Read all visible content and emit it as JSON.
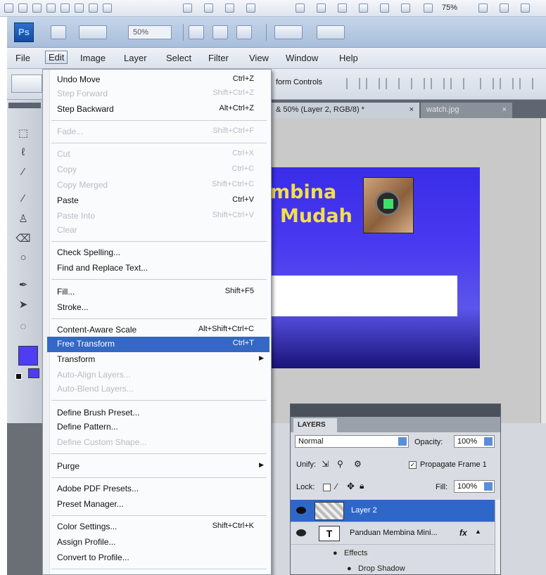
{
  "quicklaunch": {
    "zoom": "75%"
  },
  "appbar": {
    "logo": "Ps",
    "zoom": "50%"
  },
  "menubar": {
    "items": [
      "File",
      "Edit",
      "Image",
      "Layer",
      "Select",
      "Filter",
      "View",
      "Window",
      "Help"
    ],
    "active": "Edit"
  },
  "options_bar": {
    "transform_controls": "form Controls"
  },
  "document_tabs": {
    "active": "& 50% (Layer 2, RGB/8) *",
    "active_close": "×",
    "inactive": "watch.jpg",
    "inactive_close": "×"
  },
  "canvas": {
    "title_line1": "mbina",
    "title_line2": "Mudah",
    "colors": {
      "background_top": "#3a2de8",
      "title": "#f0e050"
    }
  },
  "edit_menu": {
    "items": [
      {
        "label": "Undo Move",
        "shortcut": "Ctrl+Z",
        "enabled": true
      },
      {
        "label": "Step Forward",
        "shortcut": "Shift+Ctrl+Z",
        "enabled": false
      },
      {
        "label": "Step Backward",
        "shortcut": "Alt+Ctrl+Z",
        "enabled": true
      },
      {
        "label": "Fade...",
        "shortcut": "Shift+Ctrl+F",
        "enabled": false
      },
      {
        "label": "Cut",
        "shortcut": "Ctrl+X",
        "enabled": false
      },
      {
        "label": "Copy",
        "shortcut": "Ctrl+C",
        "enabled": false
      },
      {
        "label": "Copy Merged",
        "shortcut": "Shift+Ctrl+C",
        "enabled": false
      },
      {
        "label": "Paste",
        "shortcut": "Ctrl+V",
        "enabled": true
      },
      {
        "label": "Paste Into",
        "shortcut": "Shift+Ctrl+V",
        "enabled": false
      },
      {
        "label": "Clear",
        "shortcut": "",
        "enabled": false
      },
      {
        "label": "Check Spelling...",
        "shortcut": "",
        "enabled": true
      },
      {
        "label": "Find and Replace Text...",
        "shortcut": "",
        "enabled": true
      },
      {
        "label": "Fill...",
        "shortcut": "Shift+F5",
        "enabled": true
      },
      {
        "label": "Stroke...",
        "shortcut": "",
        "enabled": true
      },
      {
        "label": "Content-Aware Scale",
        "shortcut": "Alt+Shift+Ctrl+C",
        "enabled": true
      },
      {
        "label": "Free Transform",
        "shortcut": "Ctrl+T",
        "enabled": true,
        "highlighted": true
      },
      {
        "label": "Transform",
        "shortcut": "",
        "enabled": true,
        "submenu": true
      },
      {
        "label": "Auto-Align Layers...",
        "shortcut": "",
        "enabled": false
      },
      {
        "label": "Auto-Blend Layers...",
        "shortcut": "",
        "enabled": false
      },
      {
        "label": "Define Brush Preset...",
        "shortcut": "",
        "enabled": true
      },
      {
        "label": "Define Pattern...",
        "shortcut": "",
        "enabled": true
      },
      {
        "label": "Define Custom Shape...",
        "shortcut": "",
        "enabled": false
      },
      {
        "label": "Purge",
        "shortcut": "",
        "enabled": true,
        "submenu": true
      },
      {
        "label": "Adobe PDF Presets...",
        "shortcut": "",
        "enabled": true
      },
      {
        "label": "Preset Manager...",
        "shortcut": "",
        "enabled": true
      },
      {
        "label": "Color Settings...",
        "shortcut": "Shift+Ctrl+K",
        "enabled": true
      },
      {
        "label": "Assign Profile...",
        "shortcut": "",
        "enabled": true
      },
      {
        "label": "Convert to Profile...",
        "shortcut": "",
        "enabled": true
      }
    ]
  },
  "layers_panel": {
    "tab": "LAYERS",
    "blend_mode": "Normal",
    "opacity_label": "Opacity:",
    "opacity": "100%",
    "unify_label": "Unify:",
    "propagate_label": "Propagate Frame 1",
    "lock_label": "Lock:",
    "fill_label": "Fill:",
    "fill": "100%",
    "layers": [
      {
        "name": "Layer 2",
        "selected": true
      },
      {
        "name": "Panduan Membina Mini...",
        "selected": false,
        "type": "text",
        "thumb": "T",
        "fx": "fx"
      }
    ],
    "effects_label": "Effects",
    "effect": "Drop Shadow",
    "colors": {
      "selection": "#2f67c9"
    }
  },
  "toolbox": {
    "foreground_color": "#4f3df4"
  }
}
